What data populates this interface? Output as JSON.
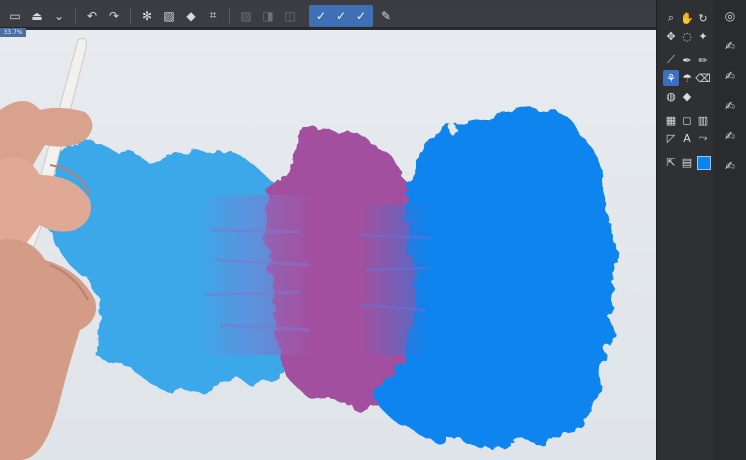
{
  "app": {
    "zoom_label": "33.7%"
  },
  "toolbar": {
    "buttons": [
      {
        "name": "open-file-icon",
        "glyph": "▭"
      },
      {
        "name": "save-icon",
        "glyph": "⏏"
      },
      {
        "name": "dropdown-icon",
        "glyph": "⌄"
      },
      {
        "name": "undo-icon",
        "glyph": "↶"
      },
      {
        "name": "redo-icon",
        "glyph": "↷"
      },
      {
        "name": "settings-icon",
        "glyph": "✻"
      },
      {
        "name": "layer-copy-icon",
        "glyph": "▨"
      },
      {
        "name": "fill-icon",
        "glyph": "◆"
      },
      {
        "name": "transform-icon",
        "glyph": "⌗"
      },
      {
        "name": "mask-off-icon",
        "glyph": "▧"
      },
      {
        "name": "ruler-icon",
        "glyph": "◨"
      },
      {
        "name": "frame-icon",
        "glyph": "◫"
      }
    ],
    "active_group": [
      {
        "name": "stabilizer-icon-1",
        "glyph": "✓"
      },
      {
        "name": "stabilizer-icon-2",
        "glyph": "✓"
      },
      {
        "name": "stabilizer-icon-3",
        "glyph": "✓"
      }
    ],
    "extra": {
      "name": "edit-icon",
      "glyph": "✎"
    }
  },
  "tools": [
    {
      "name": "zoom-icon",
      "glyph": "⌕"
    },
    {
      "name": "hand-icon",
      "glyph": "✋"
    },
    {
      "name": "rotate-icon",
      "glyph": "↻"
    },
    {
      "name": "move-icon",
      "glyph": "✥"
    },
    {
      "name": "lasso-icon",
      "glyph": "◌"
    },
    {
      "name": "magic-wand-icon",
      "glyph": "✦"
    },
    {
      "name": "eyedropper-icon",
      "glyph": "⟋"
    },
    {
      "name": "pen-icon",
      "glyph": "✒"
    },
    {
      "name": "pencil-icon",
      "glyph": "✏"
    },
    {
      "name": "brush-icon",
      "glyph": "⚘",
      "active": true
    },
    {
      "name": "airbrush-icon",
      "glyph": "☂"
    },
    {
      "name": "eraser-icon",
      "glyph": "⌫"
    },
    {
      "name": "blend-icon",
      "glyph": "◍"
    },
    {
      "name": "bucket-icon",
      "glyph": "◆"
    },
    {
      "name": "gradient-icon",
      "glyph": "▦"
    },
    {
      "name": "figure-icon",
      "glyph": "◻"
    },
    {
      "name": "frame-border-icon",
      "glyph": "▥"
    },
    {
      "name": "balloon-icon",
      "glyph": "◸"
    },
    {
      "name": "text-icon",
      "glyph": "A"
    },
    {
      "name": "correct-line-icon",
      "glyph": "⤳"
    },
    {
      "name": "object-select-icon",
      "glyph": "⇱"
    },
    {
      "name": "layer-move-icon",
      "glyph": "▤"
    }
  ],
  "sub_tools": [
    {
      "name": "navigator-icon",
      "glyph": "◎"
    },
    {
      "name": "brush-preset-icon-1",
      "glyph": "✍"
    },
    {
      "name": "brush-preset-icon-2",
      "glyph": "✍"
    },
    {
      "name": "brush-preset-icon-3",
      "glyph": "✍"
    },
    {
      "name": "brush-preset-icon-4",
      "glyph": "✍"
    },
    {
      "name": "brush-preset-icon-5",
      "glyph": "✍"
    }
  ],
  "colors": {
    "light_blue": "#3aa8ea",
    "purple": "#a3509f",
    "bright_blue": "#0a84ee",
    "canvas": "#e3e8ec",
    "accent": "#3c6fc0"
  }
}
